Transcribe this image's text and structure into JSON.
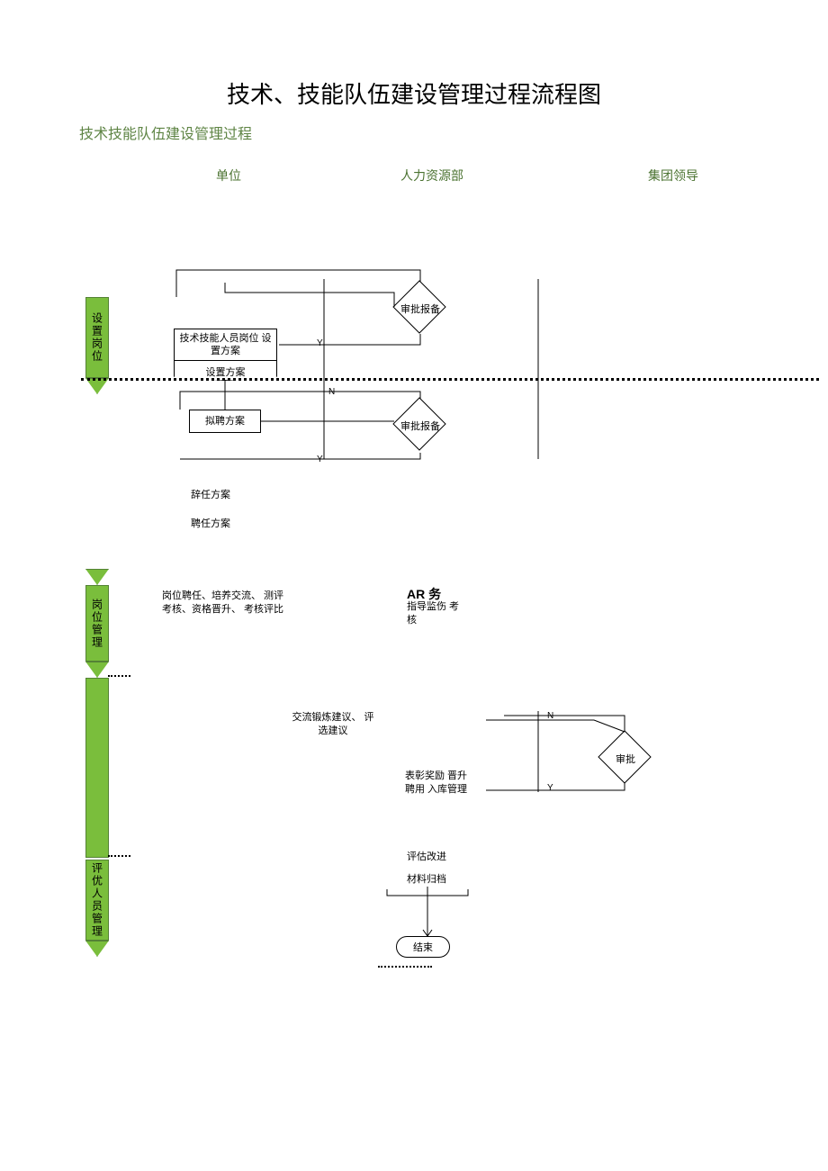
{
  "title": "技术、技能队伍建设管理过程流程图",
  "subtitle": "技术技能队伍建设管理过程",
  "columns": {
    "c1": "单位",
    "c2": "人力资源部",
    "c3": "集团领导"
  },
  "swimlanes": {
    "s1": "设置岗位",
    "s2": "岗位管理",
    "s3": "评优人员管理"
  },
  "nodes": {
    "approve1": "审批报备",
    "planbox": "技术技能人员岗位\n设置方案",
    "plandoc": "设置方案",
    "recruit": "拟聘方案",
    "approve2": "审批报备",
    "dismiss": "辞任方案",
    "hire": "聘任方案",
    "mgmt": "岗位聘任、培养交流、\n测评考核、资格晋升、\n考核评比",
    "ar": "AR 务",
    "ar2": "指导监伤\n考核",
    "suggest": "交流锻炼建议、\n评选建议",
    "reward": "表彰奖励\n晋升聘用\n入库管理",
    "approve3": "审批",
    "eval": "评估改进",
    "archive": "材料归档",
    "end": "结束"
  },
  "labels": {
    "y": "Y",
    "n": "N"
  }
}
